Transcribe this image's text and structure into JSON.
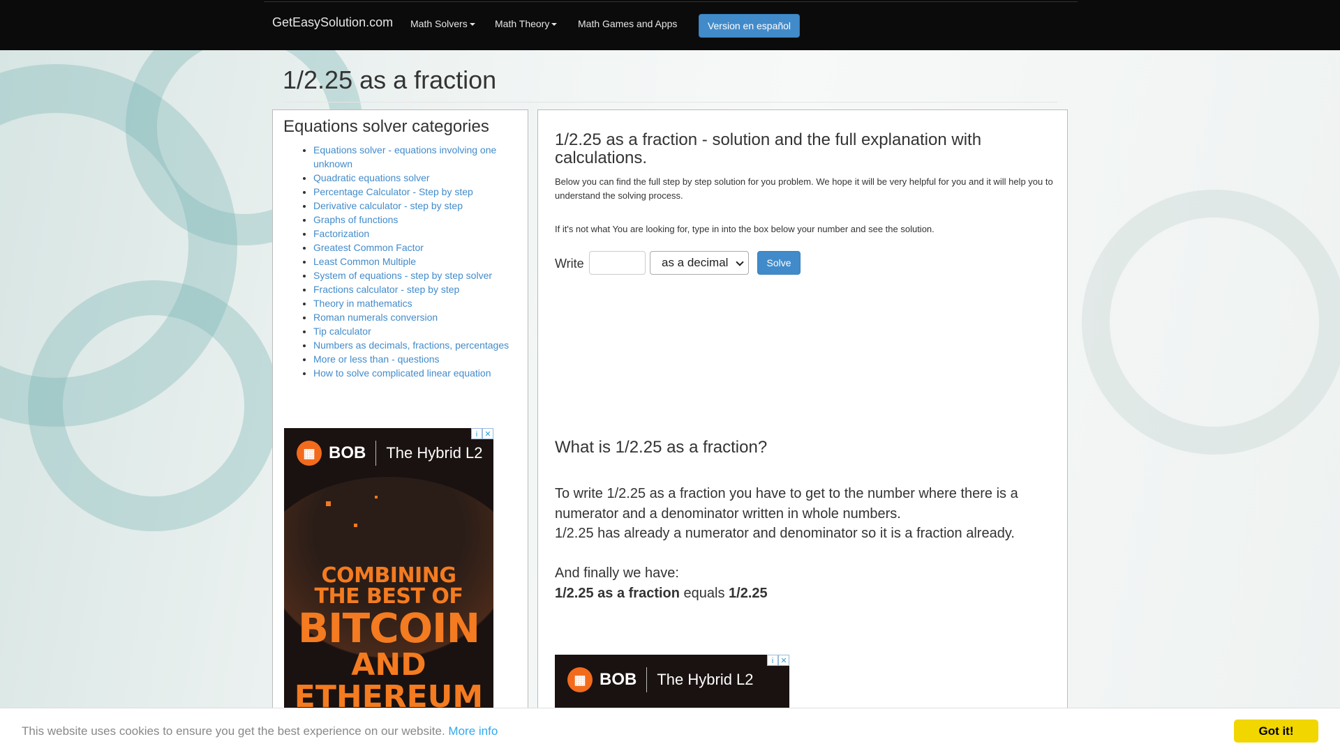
{
  "navbar": {
    "brand": "GetEasySolution.com",
    "items": [
      {
        "label": "Math Solvers",
        "dropdown": true
      },
      {
        "label": "Math Theory",
        "dropdown": true
      },
      {
        "label": "Math Games and Apps",
        "dropdown": false
      }
    ],
    "spanish_button": "Version en español"
  },
  "page": {
    "title": "1/2.25 as a fraction"
  },
  "sidebar": {
    "heading": "Equations solver categories",
    "items": [
      "Equations solver - equations involving one unknown",
      "Quadratic equations solver",
      "Percentage Calculator - Step by step",
      "Derivative calculator - step by step",
      "Graphs of functions",
      "Factorization",
      "Greatest Common Factor",
      "Least Common Multiple",
      "System of equations - step by step solver",
      "Fractions calculator - step by step",
      "Theory in mathematics",
      "Roman numerals conversion",
      "Tip calculator",
      "Numbers as decimals, fractions, percentages",
      "More or less than - questions",
      "How to solve complicated linear equation"
    ]
  },
  "ads": {
    "brand": "BOB",
    "product": "The Hybrid L2",
    "headline_1": "COMBINING",
    "headline_2": "THE BEST OF",
    "headline_3": "BITCOIN",
    "headline_4": "AND",
    "headline_5": "ETHEREUM",
    "info_glyph": "i",
    "close_glyph": "✕"
  },
  "main": {
    "heading": "1/2.25 as a fraction - solution and the full explanation with calculations.",
    "intro": "Below you can find the full step by step solution for you problem. We hope it will be very helpful for you and it will help you to understand the solving process.",
    "hint": "If it's not what You are looking for, type in into the box below your number and see the solution.",
    "write_label": "Write",
    "input_value": "",
    "select_value": "as a decimal",
    "solve_label": "Solve",
    "question": "What is 1/2.25 as a fraction?",
    "explanation_1": "To write 1/2.25 as a fraction you have to get to the number where there is a numerator and a denominator written in whole numbers.",
    "explanation_2": "1/2.25 has already a numerator and denominator so it is a fraction already.",
    "finally": "And finally we have:",
    "result_lhs": "1/2.25 as a fraction",
    "result_mid": "equals",
    "result_rhs": "1/2.25"
  },
  "cookie": {
    "message": "This website uses cookies to ensure you get the best experience on our website.",
    "more_info": "More info",
    "accept": "Got it!"
  }
}
